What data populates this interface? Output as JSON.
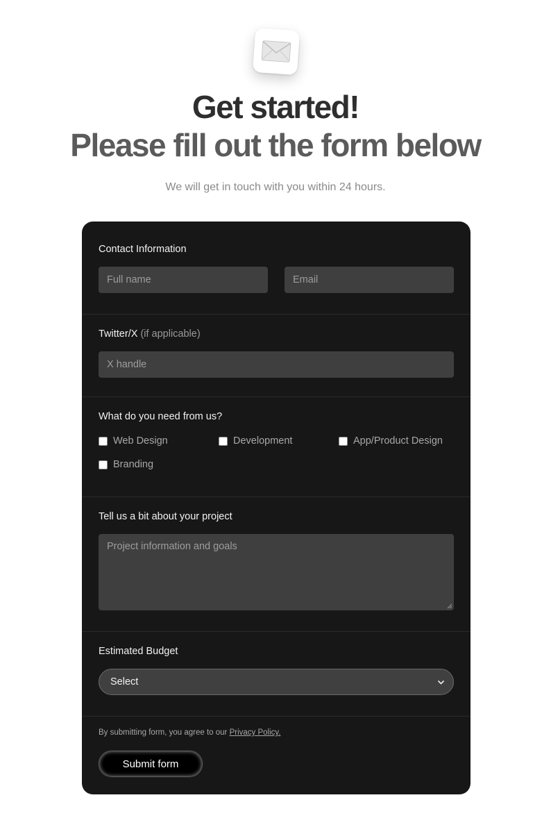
{
  "header": {
    "icon": "envelope-icon",
    "title_line1": "Get started!",
    "title_line2": "Please fill out the form below",
    "subtitle": "We will get in touch with you within 24 hours."
  },
  "form": {
    "contact": {
      "label": "Contact Information",
      "fullname_placeholder": "Full name",
      "email_placeholder": "Email"
    },
    "twitter": {
      "label": "Twitter/X",
      "label_hint": "(if applicable)",
      "placeholder": "X handle"
    },
    "services": {
      "label": "What do you need from us?",
      "options": [
        "Web Design",
        "Development",
        "App/Product Design",
        "Branding"
      ]
    },
    "project": {
      "label": "Tell us a bit about your project",
      "placeholder": "Project information and goals"
    },
    "budget": {
      "label": "Estimated Budget",
      "selected": "Select"
    },
    "consent": {
      "text": "By submitting form, you agree to our ",
      "link": "Privacy Policy."
    },
    "submit_label": "Submit form"
  },
  "colors": {
    "card_bg": "#171717",
    "field_bg": "#3f3f3f",
    "title_dark": "#2e2e2e",
    "title_gray": "#5b5b5b"
  }
}
